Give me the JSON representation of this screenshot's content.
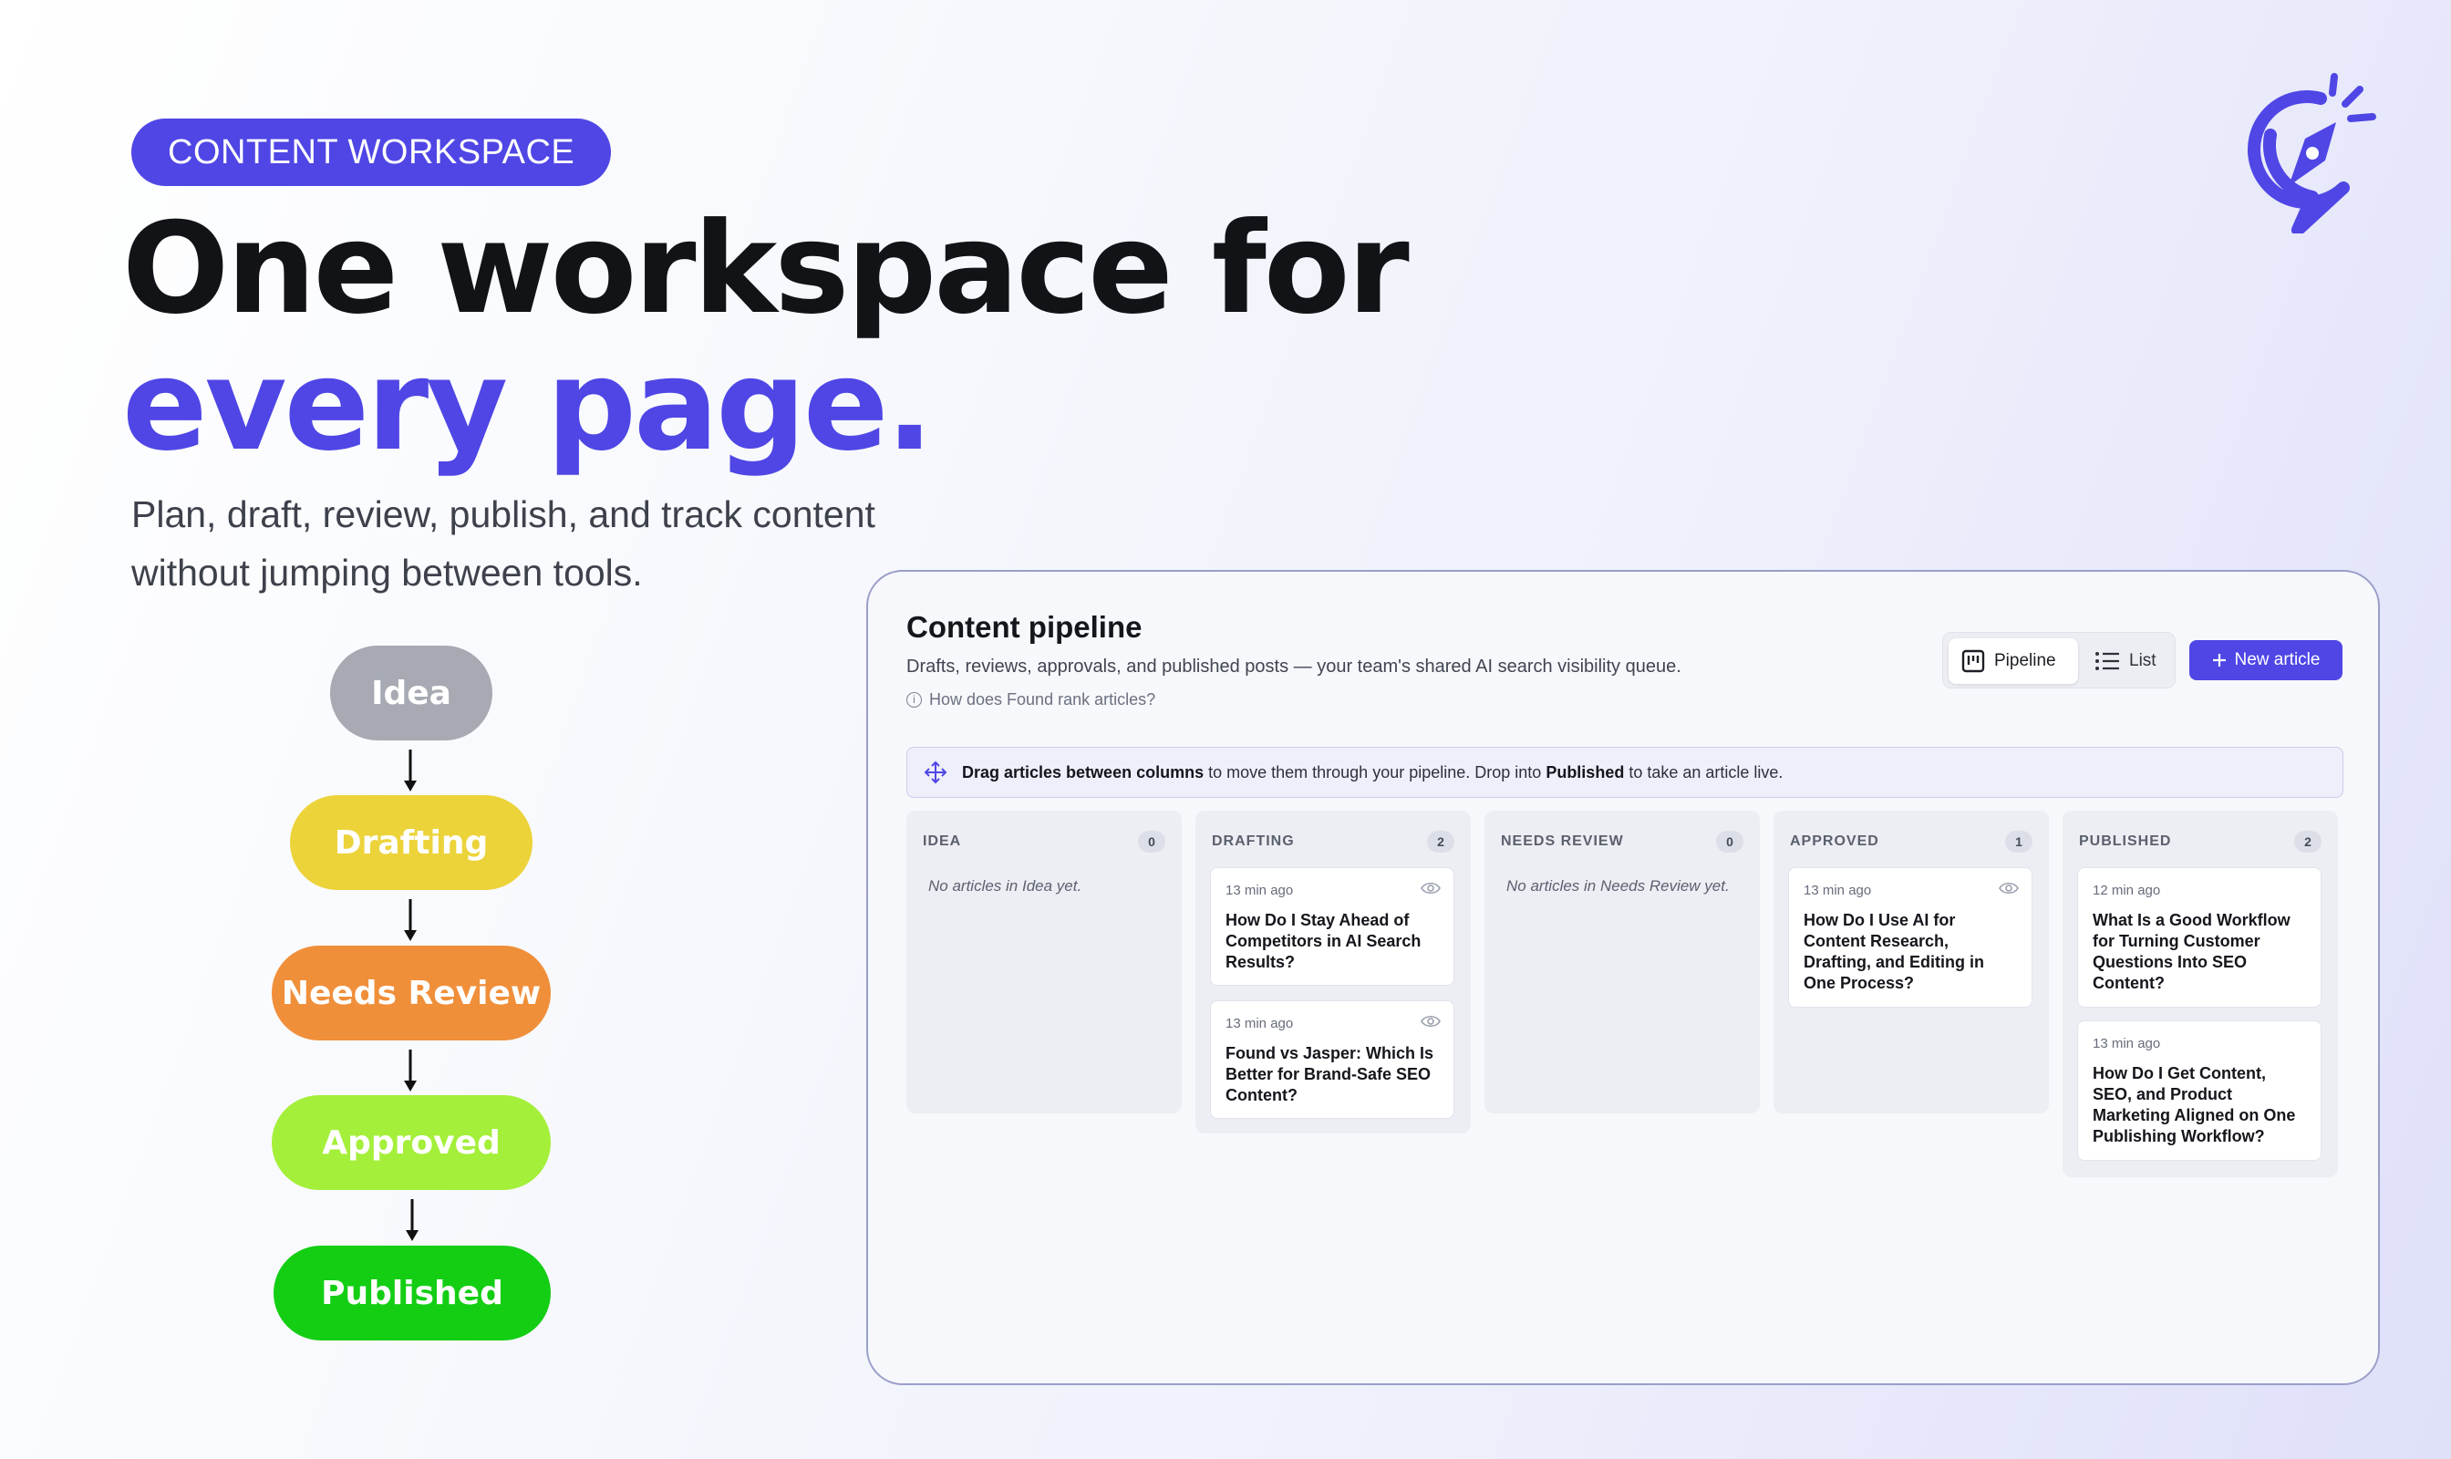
{
  "hero": {
    "badge": "CONTENT WORKSPACE",
    "headline_line1": "One workspace for",
    "headline_line2": "every page.",
    "subhead_line1": "Plan, draft, review, publish, and track content",
    "subhead_line2": "without jumping between tools.",
    "accent_color": "#4f46e5"
  },
  "flow": {
    "steps": [
      {
        "label": "Idea",
        "color": "#a7aab2"
      },
      {
        "label": "Drafting",
        "color": "#ecd33a"
      },
      {
        "label": "Needs Review",
        "color": "#f08f3a"
      },
      {
        "label": "Approved",
        "color": "#a4ef3a"
      },
      {
        "label": "Published",
        "color": "#14ce14"
      }
    ]
  },
  "window": {
    "title": "Content pipeline",
    "description": "Drafts, reviews, approvals, and published posts — your team's shared AI search visibility queue.",
    "help_link": "How does Found rank articles?",
    "view_toggle": {
      "pipeline_label": "Pipeline",
      "list_label": "List"
    },
    "new_article_label": "New article",
    "banner": {
      "bold1": "Drag articles between columns",
      "text1": " to move them through your pipeline. Drop into ",
      "bold2": "Published",
      "text2": " to take an article live."
    },
    "columns": [
      {
        "name": "IDEA",
        "count": "0",
        "empty": "No articles in Idea yet.",
        "cards": []
      },
      {
        "name": "DRAFTING",
        "count": "2",
        "empty": "",
        "cards": [
          {
            "time": "13 min ago",
            "title": "How Do I Stay Ahead of Competitors in AI Search Results?",
            "icon": "eye-icon"
          },
          {
            "time": "13 min ago",
            "title": "Found vs Jasper: Which Is Better for Brand-Safe SEO Content?",
            "icon": "eye-icon"
          }
        ]
      },
      {
        "name": "NEEDS REVIEW",
        "count": "0",
        "empty": "No articles in Needs Review yet.",
        "cards": []
      },
      {
        "name": "APPROVED",
        "count": "1",
        "empty": "",
        "cards": [
          {
            "time": "13 min ago",
            "title": "How Do I Use AI for Content Research, Drafting, and Editing in One Process?",
            "icon": "eye-icon"
          }
        ]
      },
      {
        "name": "PUBLISHED",
        "count": "2",
        "empty": "",
        "cards": [
          {
            "time": "12 min ago",
            "title": "What Is a Good Workflow for Turning Customer Questions Into SEO Content?"
          },
          {
            "time": "13 min ago",
            "title": "How Do I Get Content, SEO, and Product Marketing Aligned on One Publishing Workflow?"
          }
        ]
      }
    ]
  }
}
